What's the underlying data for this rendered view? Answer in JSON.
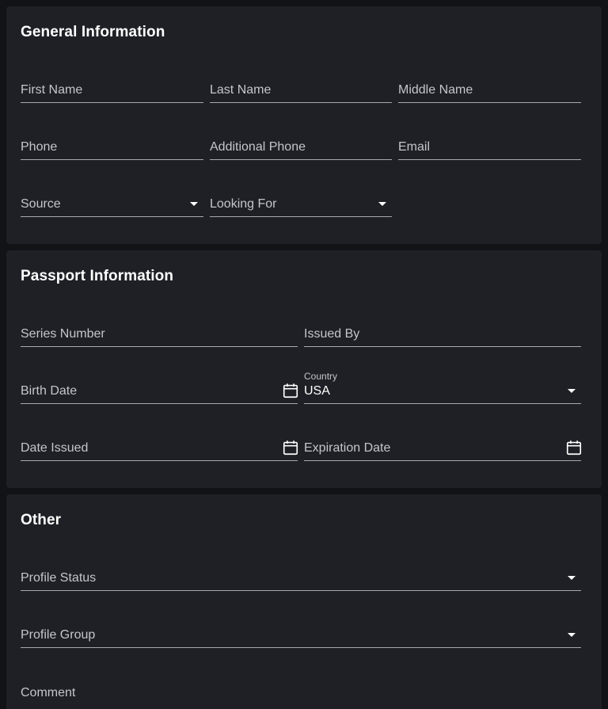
{
  "general": {
    "title": "General Information",
    "first_name_label": "First Name",
    "last_name_label": "Last Name",
    "middle_name_label": "Middle Name",
    "phone_label": "Phone",
    "additional_phone_label": "Additional Phone",
    "email_label": "Email",
    "source_label": "Source",
    "looking_for_label": "Looking For"
  },
  "passport": {
    "title": "Passport Information",
    "series_number_label": "Series Number",
    "issued_by_label": "Issued By",
    "birth_date_label": "Birth Date",
    "country_label": "Country",
    "country_value": "USA",
    "date_issued_label": "Date Issued",
    "expiration_date_label": "Expiration Date"
  },
  "other": {
    "title": "Other",
    "profile_status_label": "Profile Status",
    "profile_group_label": "Profile Group",
    "comment_label": "Comment"
  },
  "icons": {
    "dropdown": "chevron-down-icon",
    "date_picker": "calendar-icon"
  },
  "colors": {
    "page_background": "#121316",
    "card_background": "#1f2026",
    "underline": "#a7a9ae",
    "label_text": "#c4c6cb",
    "heading_text": "#ffffff"
  }
}
